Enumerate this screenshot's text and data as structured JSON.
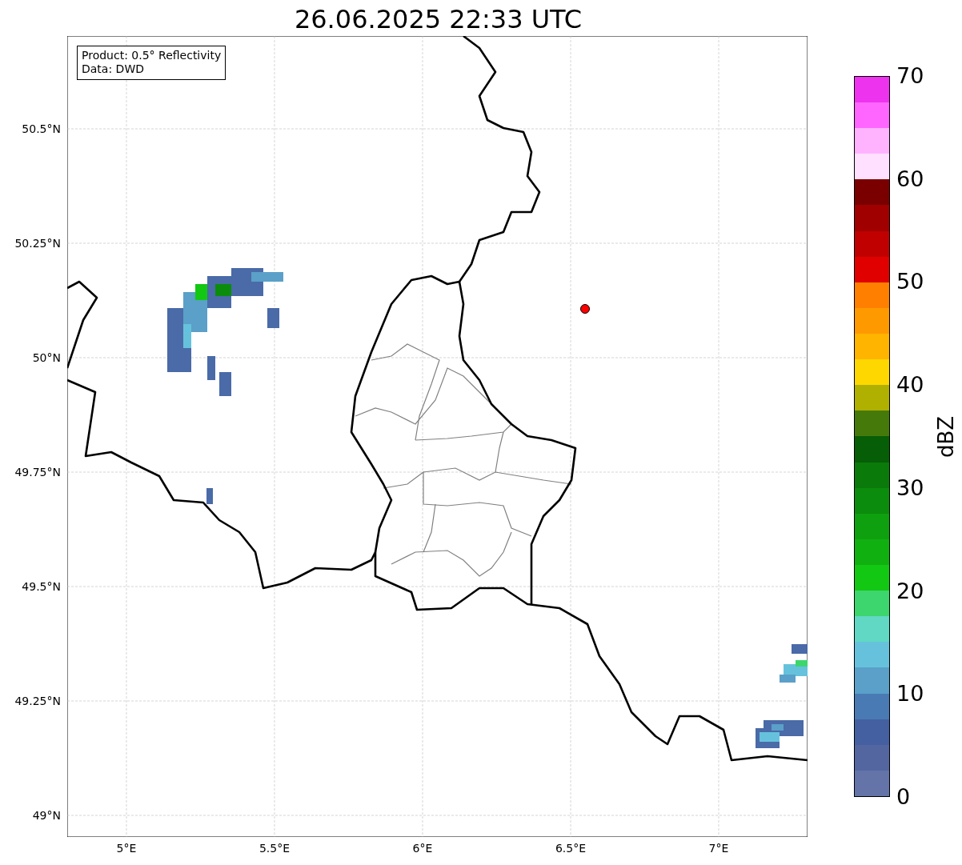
{
  "title": "26.06.2025 22:33 UTC",
  "legend": [
    "Product: 0.5° Reflectivity",
    "Data: DWD"
  ],
  "y_ticks": [
    "50.5°N",
    "50.25°N",
    "50°N",
    "49.75°N",
    "49.5°N",
    "49.25°N",
    "49°N"
  ],
  "x_ticks": [
    "5°E",
    "5.5°E",
    "6°E",
    "6.5°E",
    "7°E"
  ],
  "colorbar": {
    "label": "dBZ",
    "ticks": [
      "70",
      "60",
      "50",
      "40",
      "30",
      "20",
      "10",
      "0"
    ],
    "segments": [
      {
        "color": "#6473a8"
      },
      {
        "color": "#5466a0"
      },
      {
        "color": "#4460a0"
      },
      {
        "color": "#4a7ab4"
      },
      {
        "color": "#5aa0c8"
      },
      {
        "color": "#66c2dc"
      },
      {
        "color": "#60d8c4"
      },
      {
        "color": "#3dd56d"
      },
      {
        "color": "#12c812"
      },
      {
        "color": "#10b010"
      },
      {
        "color": "#0ea00e"
      },
      {
        "color": "#0c8c0c"
      },
      {
        "color": "#0a7a0a"
      },
      {
        "color": "#065e06"
      },
      {
        "color": "#457a0a"
      },
      {
        "color": "#b0b000"
      },
      {
        "color": "#ffd700"
      },
      {
        "color": "#ffb400"
      },
      {
        "color": "#ff9900"
      },
      {
        "color": "#ff7f00"
      },
      {
        "color": "#e00000"
      },
      {
        "color": "#c00000"
      },
      {
        "color": "#a00000"
      },
      {
        "color": "#7a0000"
      },
      {
        "color": "#ffe0ff"
      },
      {
        "color": "#ffb3ff"
      },
      {
        "color": "#ff66ff"
      },
      {
        "color": "#ee33ee"
      }
    ]
  }
}
